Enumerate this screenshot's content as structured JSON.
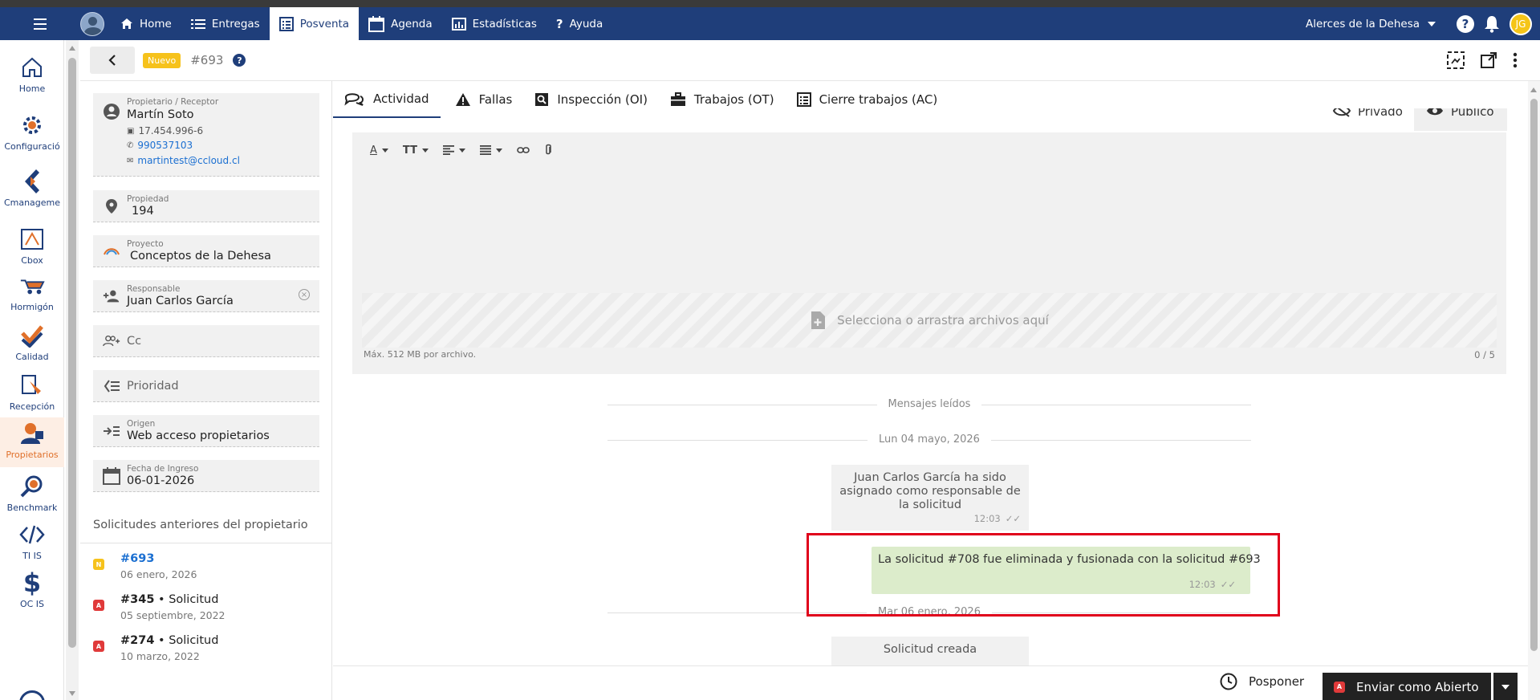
{
  "topnav": {
    "items": [
      {
        "label": "Home",
        "icon": "home-icon"
      },
      {
        "label": "Entregas",
        "icon": "list-icon"
      },
      {
        "label": "Posventa",
        "icon": "table-icon"
      },
      {
        "label": "Agenda",
        "icon": "calendar-icon"
      },
      {
        "label": "Estadísticas",
        "icon": "bar-chart-icon"
      },
      {
        "label": "Ayuda",
        "icon": "question-icon"
      }
    ],
    "active": "Posventa",
    "org": "Alerces de la Dehesa",
    "user_initials": "JG"
  },
  "app_sidebar": {
    "items": [
      {
        "label": "Home",
        "icon": "home-outline-icon"
      },
      {
        "label": "Configuració",
        "icon": "gear-icon"
      },
      {
        "label": "Cmanageme",
        "icon": "cmanagement-icon"
      },
      {
        "label": "Cbox",
        "icon": "cbox-icon"
      },
      {
        "label": "Hormigón",
        "icon": "wheelbarrow-icon"
      },
      {
        "label": "Calidad",
        "icon": "quality-icon"
      },
      {
        "label": "Recepción",
        "icon": "reception-icon"
      },
      {
        "label": "Propietarios",
        "icon": "owners-icon"
      },
      {
        "label": "Benchmark",
        "icon": "benchmark-icon"
      },
      {
        "label": "TI IS",
        "icon": "code-icon"
      },
      {
        "label": "OC IS",
        "icon": "dollar-icon"
      }
    ],
    "active": "Propietarios"
  },
  "subheader": {
    "status": "Nuevo",
    "ticket_id": "#693",
    "status_color": "#f6c21b"
  },
  "details": {
    "owner": {
      "label": "Propietario / Receptor",
      "name": "Martín Soto",
      "rut": "17.454.996-6",
      "phone": "990537103",
      "email": "martintest@ccloud.cl"
    },
    "propiedad": {
      "label": "Propiedad",
      "value": "194"
    },
    "proyecto": {
      "label": "Proyecto",
      "value": "Conceptos de la Dehesa"
    },
    "responsable": {
      "label": "Responsable",
      "value": "Juan Carlos García"
    },
    "cc": {
      "placeholder": "Cc"
    },
    "prioridad": {
      "placeholder": "Prioridad"
    },
    "origen": {
      "label": "Origen",
      "value": "Web acceso propietarios"
    },
    "fecha": {
      "label": "Fecha de Ingreso",
      "value": "06-01-2026"
    }
  },
  "previous": {
    "title": "Solicitudes anteriores del propietario",
    "items": [
      {
        "badge": "N",
        "badge_color": "#f6c21b",
        "id": "#693",
        "type": "",
        "date": "06 enero, 2026"
      },
      {
        "badge": "A",
        "badge_color": "#e03a3a",
        "id": "#345",
        "type": " • Solicitud",
        "date": "05 septiembre, 2022"
      },
      {
        "badge": "A",
        "badge_color": "#e03a3a",
        "id": "#274",
        "type": " • Solicitud",
        "date": "10 marzo, 2022"
      }
    ]
  },
  "tabs": [
    {
      "label": "Actividad",
      "icon": "chat-icon"
    },
    {
      "label": "Fallas",
      "icon": "warning-icon"
    },
    {
      "label": "Inspección (OI)",
      "icon": "inspection-icon"
    },
    {
      "label": "Trabajos (OT)",
      "icon": "briefcase-icon"
    },
    {
      "label": "Cierre trabajos (AC)",
      "icon": "checklist-icon"
    }
  ],
  "editor": {
    "private_label": "Privado",
    "public_label": "Público",
    "dropzone_text": "Selecciona o arrastra archivos aquí",
    "max_size": "Máx. 512 MB por archivo.",
    "file_count": "0 / 5"
  },
  "chat": {
    "read_divider": "Mensajes leídos",
    "date1": "Lun 04 mayo, 2026",
    "msg1": "Juan Carlos García ha sido asignado como responsable de la solicitud",
    "msg1_time": "12:03",
    "msg2": "La solicitud #708 fue eliminada y fusionada con la solicitud #693",
    "msg2_time": "12:03",
    "date2": "Mar 06 enero, 2026",
    "msg3": "Solicitud creada"
  },
  "footer": {
    "postpone": "Posponer",
    "send_label": "Enviar como Abierto",
    "send_badge": "A"
  }
}
